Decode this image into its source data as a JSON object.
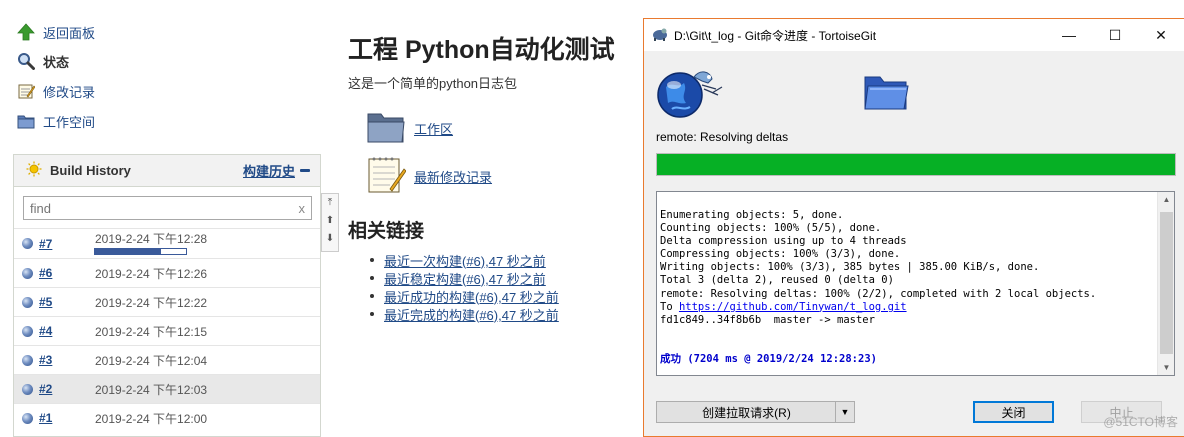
{
  "jenkins": {
    "sidebar": {
      "tasks": [
        {
          "label": "返回面板",
          "icon": "up-arrow-icon"
        },
        {
          "label": "状态",
          "icon": "search-icon"
        },
        {
          "label": "修改记录",
          "icon": "notepad-icon"
        },
        {
          "label": "工作空间",
          "icon": "folder-icon"
        }
      ]
    },
    "build_history": {
      "title": "Build History",
      "trend_link": "构建历史",
      "search_placeholder": "find",
      "search_clear": "x",
      "builds": [
        {
          "number": "#7",
          "time": "2019-2-24 下午12:28",
          "in_progress": true,
          "progress": 0.72
        },
        {
          "number": "#6",
          "time": "2019-2-24 下午12:26"
        },
        {
          "number": "#5",
          "time": "2019-2-24 下午12:22"
        },
        {
          "number": "#4",
          "time": "2019-2-24 下午12:15"
        },
        {
          "number": "#3",
          "time": "2019-2-24 下午12:04"
        },
        {
          "number": "#2",
          "time": "2019-2-24 下午12:03"
        },
        {
          "number": "#1",
          "time": "2019-2-24 下午12:00"
        }
      ],
      "pager": {
        "first": "⤒",
        "up": "⬆",
        "down": "⬇"
      }
    },
    "main": {
      "title": "工程 Python自动化测试",
      "description": "这是一个简单的python日志包",
      "links": [
        {
          "label": "工作区",
          "icon": "folder-icon"
        },
        {
          "label": "最新修改记录",
          "icon": "notepad-icon"
        }
      ],
      "related_title": "相关链接",
      "related_links": [
        "最近一次构建(#6),47 秒之前",
        "最近稳定构建(#6),47 秒之前",
        "最近成功的构建(#6),47 秒之前",
        "最近完成的构建(#6),47 秒之前"
      ]
    }
  },
  "dialog": {
    "title": "D:\\Git\\t_log - Git命令进度 - TortoiseGit",
    "window_buttons": {
      "minimize": "—",
      "maximize": "☐",
      "close": "✕"
    },
    "status": "remote: Resolving deltas",
    "progress": 1.0,
    "progress_color": "#06b025",
    "log_lines": [
      "Enumerating objects: 5, done.",
      "Counting objects: 100% (5/5), done.",
      "Delta compression using up to 4 threads",
      "Compressing objects: 100% (3/3), done.",
      "Writing objects: 100% (3/3), 385 bytes | 385.00 KiB/s, done.",
      "Total 3 (delta 2), reused 0 (delta 0)",
      "remote: Resolving deltas: 100% (2/2), completed with 2 local objects."
    ],
    "log_to_prefix": "To ",
    "log_url": "https://github.com/Tinywan/t_log.git",
    "log_ref": "fd1c849..34f8b6b  master -> master",
    "log_result": "成功 (7204 ms @ 2019/2/24 12:28:23)",
    "buttons": {
      "create_pr": "创建拉取请求(R)",
      "close": "关闭",
      "abort": "中止"
    },
    "watermark": "@51CTO博客"
  }
}
